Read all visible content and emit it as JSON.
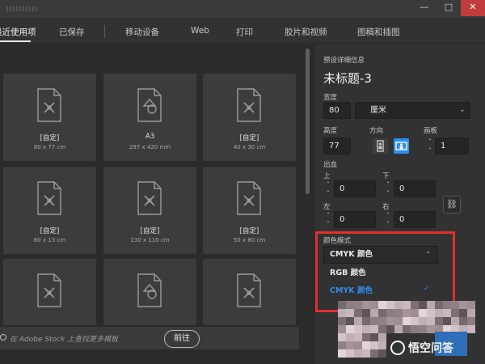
{
  "tabs": [
    {
      "label": "最近使用项"
    },
    {
      "label": "已保存"
    },
    {
      "label": "移动设备"
    },
    {
      "label": "Web"
    },
    {
      "label": "打印"
    },
    {
      "label": "胶片和视频"
    },
    {
      "label": "图稿和插图"
    }
  ],
  "window": {
    "minimize": "—",
    "restore": "□"
  },
  "presets": [
    {
      "title": "[自定]",
      "size": "80 x 77 cm",
      "icon": "pen-doc-icon"
    },
    {
      "title": "A3",
      "size": "297 x 420 mm",
      "icon": "shapes-doc-icon"
    },
    {
      "title": "[自定]",
      "size": "40 x 30 cm",
      "icon": "pen-doc-icon"
    },
    {
      "title": "[自定]",
      "size": "60 x 13 cm",
      "icon": "pen-doc-icon"
    },
    {
      "title": "[自定]",
      "size": "230 x 110 cm",
      "icon": "pen-doc-icon"
    },
    {
      "title": "[自定]",
      "size": "50 x 80 cm",
      "icon": "pen-doc-icon"
    },
    {
      "title": "",
      "size": "",
      "icon": "pen-doc-icon"
    },
    {
      "title": "",
      "size": "",
      "icon": "shapes-doc-icon"
    },
    {
      "title": "",
      "size": "",
      "icon": "pen-doc-icon"
    }
  ],
  "stock": {
    "text": "在 Adobe Stock 上查找更多模板",
    "button": "前往"
  },
  "details": {
    "section_title": "预设详细信息",
    "doc_name": "未标题-3",
    "width_label": "宽度",
    "width_value": "80",
    "unit_value": "厘米",
    "height_label": "高度",
    "height_value": "77",
    "orientation_label": "方向",
    "artboards_label": "画板",
    "artboards_value": "1",
    "bleed_label": "出血",
    "bleed_top_label": "上",
    "bleed_bottom_label": "下",
    "bleed_left_label": "左",
    "bleed_right_label": "右",
    "bleed_top": "0",
    "bleed_bottom": "0",
    "bleed_left": "0",
    "bleed_right": "0",
    "color_mode_label": "颜色模式",
    "color_mode_selected": "CMYK 颜色",
    "color_mode_options": [
      "RGB 颜色",
      "CMYK 颜色"
    ]
  },
  "watermark": {
    "text": "悟空问答"
  },
  "colors": {
    "highlight_box": "#e0302c",
    "selected_option": "#2f8cf0",
    "orient_selected": "#2f8cf0"
  }
}
